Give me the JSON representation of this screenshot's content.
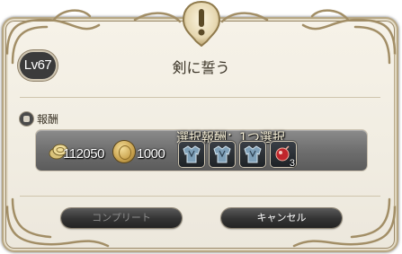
{
  "dialog": {
    "level_badge": "Lv67",
    "title": "剣に誓う"
  },
  "rewards": {
    "section_label": "報酬",
    "gil_amount": "112050",
    "coin_amount": "1000",
    "select_title": "選択報酬：1つ選択",
    "items": [
      {
        "icon": "armor-chest-icon",
        "quantity": ""
      },
      {
        "icon": "armor-chest-icon",
        "quantity": ""
      },
      {
        "icon": "armor-chest-icon",
        "quantity": ""
      },
      {
        "icon": "red-potion-icon",
        "quantity": "3"
      }
    ]
  },
  "buttons": {
    "complete_label": "コンプリート",
    "complete_enabled": false,
    "cancel_label": "キャンセル"
  },
  "colors": {
    "panel_bg": "#f1ede2",
    "frame_accent": "#b7a784",
    "reward_box": "#6f6f6f",
    "button_bg": "#353535"
  }
}
